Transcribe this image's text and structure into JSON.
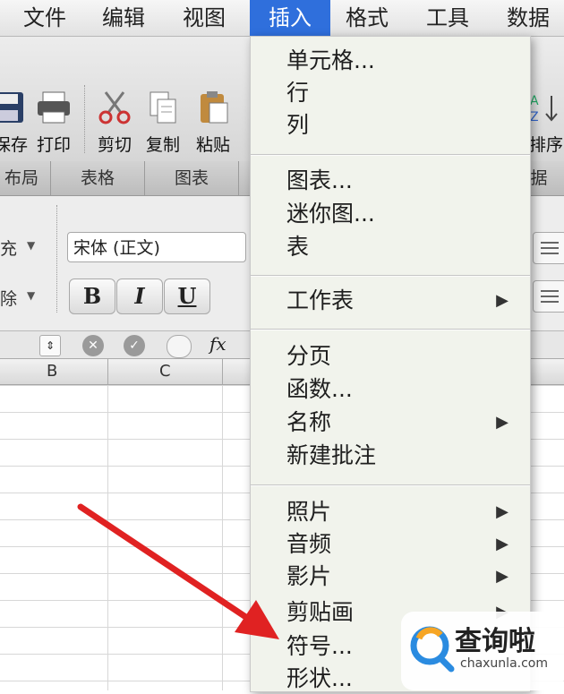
{
  "menubar": {
    "items": [
      "文件",
      "编辑",
      "视图",
      "插入",
      "格式",
      "工具",
      "数据"
    ],
    "active": "插入"
  },
  "toolbar": {
    "save": "保存",
    "print": "打印",
    "cut": "剪切",
    "copy": "复制",
    "paste": "粘贴",
    "sort": "排序"
  },
  "ribbon_tabs": [
    "布局",
    "表格",
    "图表",
    "据"
  ],
  "ribbon": {
    "font_name": "宋体 (正文)",
    "bold": "B",
    "italic": "I",
    "underline": "U",
    "fill_label": "充",
    "clear_label": "除"
  },
  "formula": {
    "fx": "fx"
  },
  "columns": [
    "B",
    "C"
  ],
  "insert_menu": {
    "group1": [
      "单元格...",
      "行",
      "列"
    ],
    "group2": [
      "图表...",
      "迷你图...",
      "表"
    ],
    "group3": [
      "工作表"
    ],
    "group4": [
      "分页",
      "函数...",
      "名称",
      "新建批注"
    ],
    "group5": [
      "照片",
      "音频",
      "影片",
      "剪贴画",
      "符号...",
      "形状..."
    ]
  },
  "watermark": {
    "name": "查询啦",
    "url": "chaxunla.com"
  },
  "colors": {
    "menu_bg": "#f1f3ec",
    "highlight": "#2f6fdc",
    "arrow": "#e02222"
  }
}
